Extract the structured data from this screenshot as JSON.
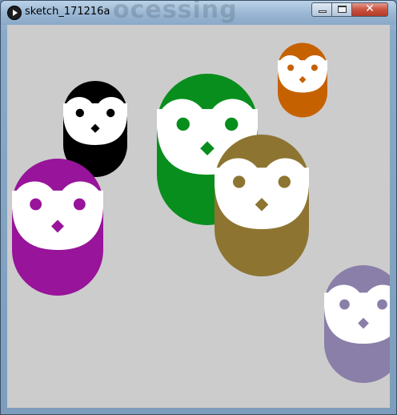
{
  "window": {
    "title": "sketch_171216a",
    "background_title_text": "ocessing",
    "close_glyph": "✕"
  },
  "canvas": {
    "background": "#cccccc"
  },
  "owls": [
    {
      "name": "owl-orange",
      "color": "#c66100"
    },
    {
      "name": "owl-black",
      "color": "#000000"
    },
    {
      "name": "owl-green",
      "color": "#088e1d"
    },
    {
      "name": "owl-purple",
      "color": "#98149a"
    },
    {
      "name": "owl-olive",
      "color": "#8d7431"
    },
    {
      "name": "owl-lavender",
      "color": "#8a7fa8"
    }
  ]
}
